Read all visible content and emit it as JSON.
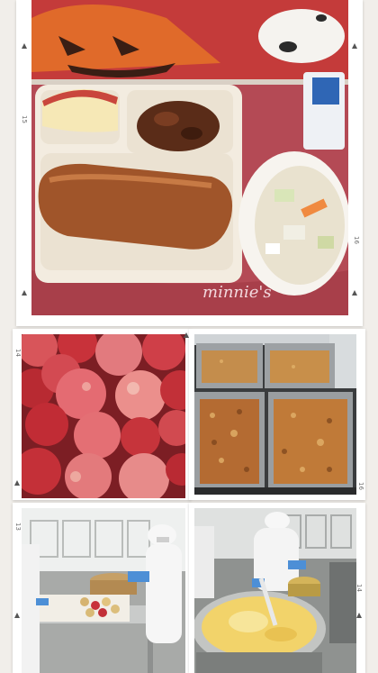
{
  "collage": {
    "photos": [
      {
        "id": "school-lunch-tray",
        "icon": "lunch-tray-photo"
      },
      {
        "id": "red-apples",
        "icon": "apples-photo"
      },
      {
        "id": "baked-trays",
        "icon": "baked-dish-photo"
      },
      {
        "id": "kitchen-apple-prep",
        "icon": "kitchen-photo"
      },
      {
        "id": "kitchen-cooking-pot",
        "icon": "cooking-pot-photo"
      }
    ],
    "page_marks": [
      "15",
      "16",
      "14",
      "16",
      "13",
      "14"
    ]
  },
  "colors": {
    "background": "#f1eeea",
    "frame": "#ffffff",
    "apple_red": "#c8323a",
    "bread_brown": "#a0552a",
    "tray_cream": "#f3ece0",
    "placemat": "#b44a55",
    "kitchen_steel": "#a8aaa8",
    "egg_yellow": "#f2d36a"
  }
}
